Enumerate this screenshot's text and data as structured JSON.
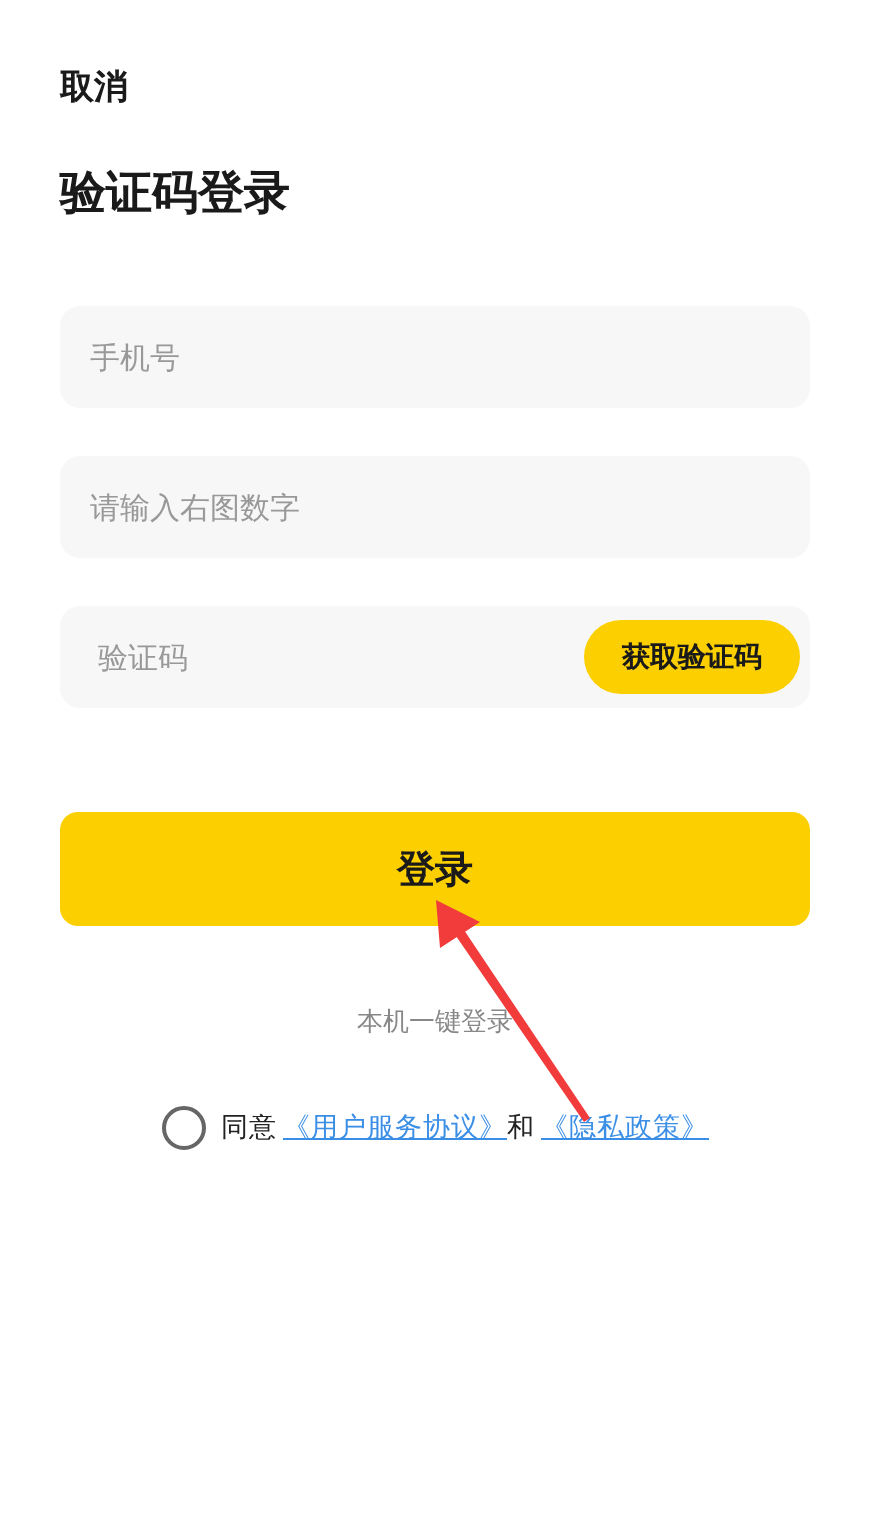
{
  "cancel": "取消",
  "title": "验证码登录",
  "fields": [
    {
      "placeholder": "手机号"
    },
    {
      "placeholder": "请输入右图数字"
    },
    {
      "placeholder": "验证码",
      "action": "获取验证码"
    }
  ],
  "login_button": "登录",
  "one_tap_login": "本机一键登录",
  "agreement": {
    "checked": false,
    "parts": [
      {
        "kind": "text",
        "text": "同意"
      },
      {
        "kind": "link",
        "text": "《用户服务协议》"
      },
      {
        "kind": "text",
        "text": "和"
      },
      {
        "kind": "link",
        "text": "《隐私政策》"
      }
    ]
  }
}
